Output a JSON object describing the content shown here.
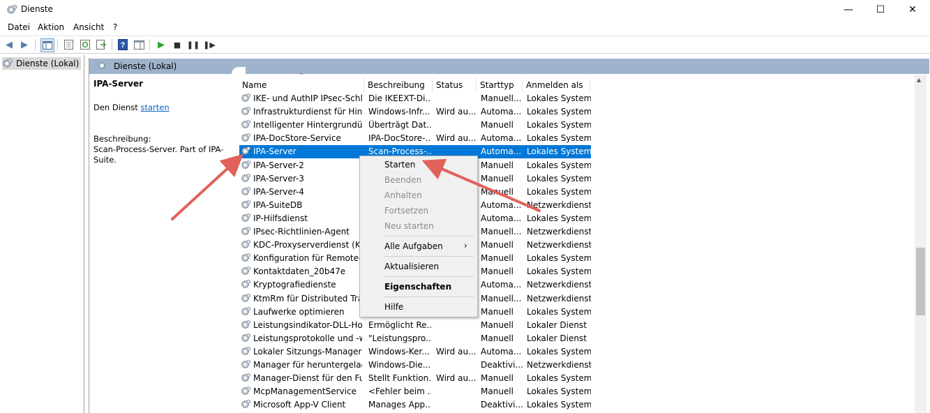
{
  "window": {
    "title": "Dienste",
    "minimize": "—",
    "maximize": "☐",
    "close": "✕"
  },
  "menu": [
    "Datei",
    "Aktion",
    "Ansicht",
    "?"
  ],
  "tree": {
    "root": "Dienste (Lokal)"
  },
  "panel": {
    "header": "Dienste (Lokal)",
    "service_name": "IPA-Server",
    "action_prefix": "Den Dienst",
    "action_link": "starten",
    "description_label": "Beschreibung:",
    "description": "Scan-Process-Server. Part of IPA-Suite."
  },
  "columns": [
    "Name",
    "Beschreibung",
    "Status",
    "Starttyp",
    "Anmelden als"
  ],
  "rows": [
    {
      "name": "IKE- und AuthIP IPsec-Schl...",
      "desc": "Die IKEEXT-Di...",
      "status": "",
      "start": "Manuell...",
      "logon": "Lokales System"
    },
    {
      "name": "Infrastrukturdienst für Hinte...",
      "desc": "Windows-Infr...",
      "status": "Wird au...",
      "start": "Automa...",
      "logon": "Lokales System"
    },
    {
      "name": "Intelligenter Hintergrundüb...",
      "desc": "Überträgt Dat...",
      "status": "",
      "start": "Manuell",
      "logon": "Lokales System"
    },
    {
      "name": "IPA-DocStore-Service",
      "desc": "IPA-DocStore-...",
      "status": "Wird au...",
      "start": "Automa...",
      "logon": "Lokales System"
    },
    {
      "name": "IPA-Server",
      "desc": "Scan-Process-...",
      "status": "",
      "start": "Automa...",
      "logon": "Lokales System"
    },
    {
      "name": "IPA-Server-2",
      "desc": "",
      "status": "",
      "start": "Manuell",
      "logon": "Lokales System"
    },
    {
      "name": "IPA-Server-3",
      "desc": "",
      "status": "",
      "start": "Manuell",
      "logon": "Lokales System"
    },
    {
      "name": "IPA-Server-4",
      "desc": "",
      "status": "",
      "start": "Manuell",
      "logon": "Lokales System"
    },
    {
      "name": "IPA-SuiteDB",
      "desc": "",
      "status": "",
      "start": "Automa...",
      "logon": "Netzwerkdienst"
    },
    {
      "name": "IP-Hilfsdienst",
      "desc": "",
      "status": "",
      "start": "Automa...",
      "logon": "Lokales System"
    },
    {
      "name": "IPsec-Richtlinien-Agent",
      "desc": "",
      "status": "",
      "start": "Manuell...",
      "logon": "Netzwerkdienst"
    },
    {
      "name": "KDC-Proxyserverdienst (KPS)",
      "desc": "",
      "status": "",
      "start": "Manuell",
      "logon": "Netzwerkdienst"
    },
    {
      "name": "Konfiguration für Remoted...",
      "desc": "",
      "status": "",
      "start": "Manuell",
      "logon": "Lokales System"
    },
    {
      "name": "Kontaktdaten_20b47e",
      "desc": "",
      "status": "",
      "start": "Manuell",
      "logon": "Lokales System"
    },
    {
      "name": "Kryptografiedienste",
      "desc": "",
      "status": "",
      "start": "Automa...",
      "logon": "Netzwerkdienst"
    },
    {
      "name": "KtmRm für Distributed Tran...",
      "desc": "",
      "status": "",
      "start": "Manuell...",
      "logon": "Netzwerkdienst"
    },
    {
      "name": "Laufwerke optimieren",
      "desc": "",
      "status": "",
      "start": "Manuell",
      "logon": "Lokales System"
    },
    {
      "name": "Leistungsindikator-DLL-Host",
      "desc": "Ermöglicht Re...",
      "status": "",
      "start": "Manuell",
      "logon": "Lokaler Dienst"
    },
    {
      "name": "Leistungsprotokolle und -w...",
      "desc": "\"Leistungspro...",
      "status": "",
      "start": "Manuell",
      "logon": "Lokaler Dienst"
    },
    {
      "name": "Lokaler Sitzungs-Manager",
      "desc": "Windows-Ker...",
      "status": "Wird au...",
      "start": "Automa...",
      "logon": "Lokales System"
    },
    {
      "name": "Manager für heruntergelad...",
      "desc": "Windows-Die...",
      "status": "",
      "start": "Deaktivi...",
      "logon": "Netzwerkdienst"
    },
    {
      "name": "Manager-Dienst für den Fu...",
      "desc": "Stellt Funktion...",
      "status": "Wird au...",
      "start": "Manuell",
      "logon": "Lokales System"
    },
    {
      "name": "McpManagementService",
      "desc": "<Fehler beim ...",
      "status": "",
      "start": "Manuell",
      "logon": "Lokales System"
    },
    {
      "name": "Microsoft App-V Client",
      "desc": "Manages App...",
      "status": "",
      "start": "Deaktivi...",
      "logon": "Lokales System"
    }
  ],
  "context_menu": {
    "start": "Starten",
    "stop": "Beenden",
    "pause": "Anhalten",
    "resume": "Fortsetzen",
    "restart": "Neu starten",
    "all_tasks": "Alle Aufgaben",
    "refresh": "Aktualisieren",
    "properties": "Eigenschaften",
    "help": "Hilfe"
  },
  "colors": {
    "selection": "#0078d7",
    "header_bar": "#9fb4cc",
    "arrow": "#e0625a"
  }
}
